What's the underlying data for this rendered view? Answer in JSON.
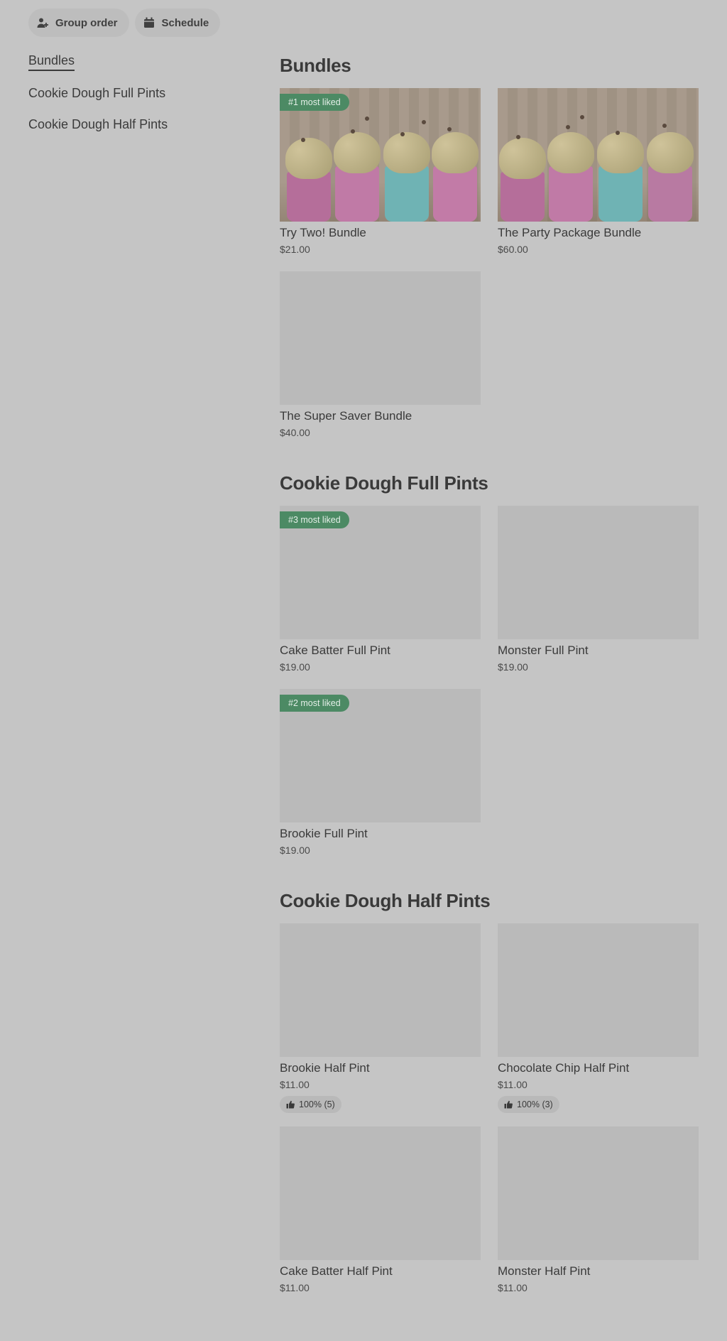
{
  "top_actions": {
    "group_order": "Group order",
    "schedule": "Schedule"
  },
  "sidebar": {
    "items": [
      {
        "label": "Bundles",
        "active": true
      },
      {
        "label": "Cookie Dough Full Pints",
        "active": false
      },
      {
        "label": "Cookie Dough Half Pints",
        "active": false
      }
    ]
  },
  "sections": [
    {
      "title": "Bundles",
      "items": [
        {
          "name": "Try Two! Bundle",
          "price": "$21.00",
          "badge": "#1 most liked",
          "photo": true
        },
        {
          "name": "The Party Package Bundle",
          "price": "$60.00",
          "photo": true
        },
        {
          "name": "The Super Saver Bundle",
          "price": "$40.00"
        }
      ]
    },
    {
      "title": "Cookie Dough Full Pints",
      "items": [
        {
          "name": "Cake Batter Full Pint",
          "price": "$19.00",
          "badge": "#3 most liked"
        },
        {
          "name": "Monster Full Pint",
          "price": "$19.00"
        },
        {
          "name": "Brookie Full Pint",
          "price": "$19.00",
          "badge": "#2 most liked"
        }
      ]
    },
    {
      "title": "Cookie Dough Half Pints",
      "items": [
        {
          "name": "Brookie Half Pint",
          "price": "$11.00",
          "rating": "100% (5)"
        },
        {
          "name": "Chocolate Chip Half Pint",
          "price": "$11.00",
          "rating": "100% (3)"
        },
        {
          "name": "Cake Batter Half Pint",
          "price": "$11.00"
        },
        {
          "name": "Monster Half Pint",
          "price": "$11.00"
        }
      ]
    }
  ]
}
